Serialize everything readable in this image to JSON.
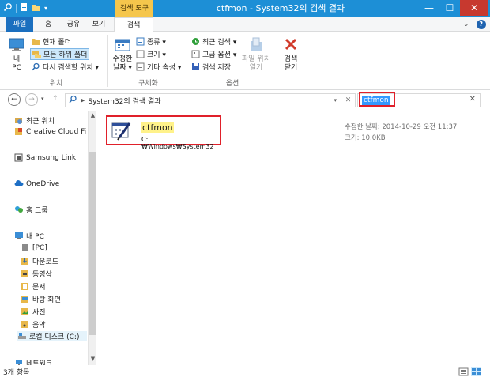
{
  "window": {
    "title": "ctfmon - System32의 검색 결과",
    "tools_tab": "검색 도구",
    "min": "—",
    "max": "☐",
    "close": "✕"
  },
  "ribbon_tabs": {
    "file": "파일",
    "home": "홈",
    "share": "공유",
    "view": "보기",
    "search": "검색",
    "active": "검색"
  },
  "ribbon": {
    "location": {
      "label": "위치",
      "my_pc_line1": "내",
      "my_pc_line2": "PC",
      "current_folder": "현재 폴더",
      "all_subfolders": "모든 하위 폴더",
      "search_again": "다시 검색할 위치 ▾"
    },
    "refine": {
      "label": "구체화",
      "modified_line1": "수정한",
      "modified_line2": "날짜 ▾",
      "kind": "종류 ▾",
      "size": "크기 ▾",
      "other_props": "기타 속성 ▾"
    },
    "options": {
      "label": "옵션",
      "recent_searches": "최근 검색 ▾",
      "advanced_options": "고급 옵션 ▾",
      "save_search": "검색 저장",
      "open_location_line1": "파일 위치",
      "open_location_line2": "열기"
    },
    "close_search": {
      "line1": "검색",
      "line2": "닫기"
    }
  },
  "address": {
    "breadcrumb": "System32의 검색 결과",
    "search_value": "ctfmon"
  },
  "nav_pane": {
    "items": [
      {
        "label": "최근 위치"
      },
      {
        "label": "Creative Cloud Fi"
      },
      {
        "label": "Samsung Link"
      },
      {
        "label": "OneDrive"
      },
      {
        "label": "홈 그룹"
      },
      {
        "label": "내 PC"
      },
      {
        "label": "[PC]"
      },
      {
        "label": "다운로드"
      },
      {
        "label": "동영상"
      },
      {
        "label": "문서"
      },
      {
        "label": "바탕 화면"
      },
      {
        "label": "사진"
      },
      {
        "label": "음악"
      },
      {
        "label": "로컬 디스크 (C:)"
      },
      {
        "label": "네트워크"
      }
    ]
  },
  "results": [
    {
      "name": "ctfmon",
      "path": "C:₩Windows₩System32",
      "modified": "수정한 날짜: 2014-10-29 오전 11:37",
      "size": "크기: 10.0KB"
    }
  ],
  "status": {
    "count": "3개 항목"
  },
  "colors": {
    "titlebar": "#1d8fd6",
    "tools_tab": "#f5c64c",
    "close_button": "#c7392f",
    "highlight_box": "#e0202a",
    "search_selection": "#3399ff",
    "name_highlight": "#fff28a"
  }
}
